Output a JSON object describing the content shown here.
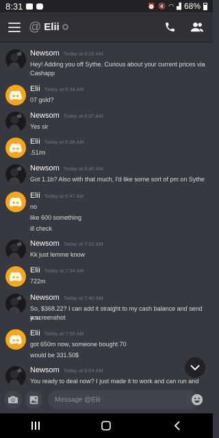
{
  "status_bar": {
    "time": "8:31",
    "battery": "68%"
  },
  "header": {
    "at_symbol": "@",
    "channel_name": "Elii",
    "call_icon": "phone-icon",
    "members_icon": "members-icon",
    "menu_icon": "hamburger-icon"
  },
  "messages": [
    {
      "author": "Newsom",
      "timestamp": "Today at 6:16 AM",
      "lines": [
        "Hey! Adding you off Sythe. Curious about your current prices via",
        "Cashapp"
      ]
    },
    {
      "author": "Elii",
      "timestamp": "Today at 6:34 AM",
      "lines": [
        "07 gold?"
      ]
    },
    {
      "author": "Newsom",
      "timestamp": "Today at 6:37 AM",
      "lines": [
        "Yes sir"
      ]
    },
    {
      "author": "Elii",
      "timestamp": "Today at 6:38 AM",
      "lines": [
        ".51/m"
      ]
    },
    {
      "author": "Newsom",
      "timestamp": "Today at 6:46 AM",
      "lines": [
        "Got 1.1b? Also with that much, I'd like some sort of pm on Sythe"
      ]
    },
    {
      "author": "Elii",
      "timestamp": "Today at 6:47 AM",
      "lines": [
        "no",
        "like 600 something",
        "ill check"
      ]
    },
    {
      "author": "Newsom",
      "timestamp": "Today at 7:22 AM",
      "lines": [
        "Kk just lemme know"
      ]
    },
    {
      "author": "Elii",
      "timestamp": "Today at 7:34 AM",
      "lines": [
        "722m"
      ]
    },
    {
      "author": "Newsom",
      "timestamp": "Today at 7:40 AM",
      "lines": [
        "So, $368.22? I can add it straight to my cash balance and send you",
        "a screenshot"
      ]
    },
    {
      "author": "Elii",
      "timestamp": "Today at 7:59 AM",
      "lines": [
        "got 650m now, someone bought 70",
        "would be 331.50$"
      ]
    },
    {
      "author": "Newsom",
      "timestamp": "Today at 8:04 AM",
      "lines": [
        "You ready to deal now? I just made it to work and can run and take"
      ]
    }
  ],
  "composer": {
    "placeholder": "Message @Elii",
    "camera_icon": "camera-icon",
    "gallery_icon": "image-icon",
    "emoji_icon": "emoji-icon"
  },
  "scroll_down_icon": "chevron-down-icon",
  "colors": {
    "background": "#36393f",
    "header": "#2f3136",
    "elii_avatar": "#faa61a",
    "text": "#dcddde"
  }
}
